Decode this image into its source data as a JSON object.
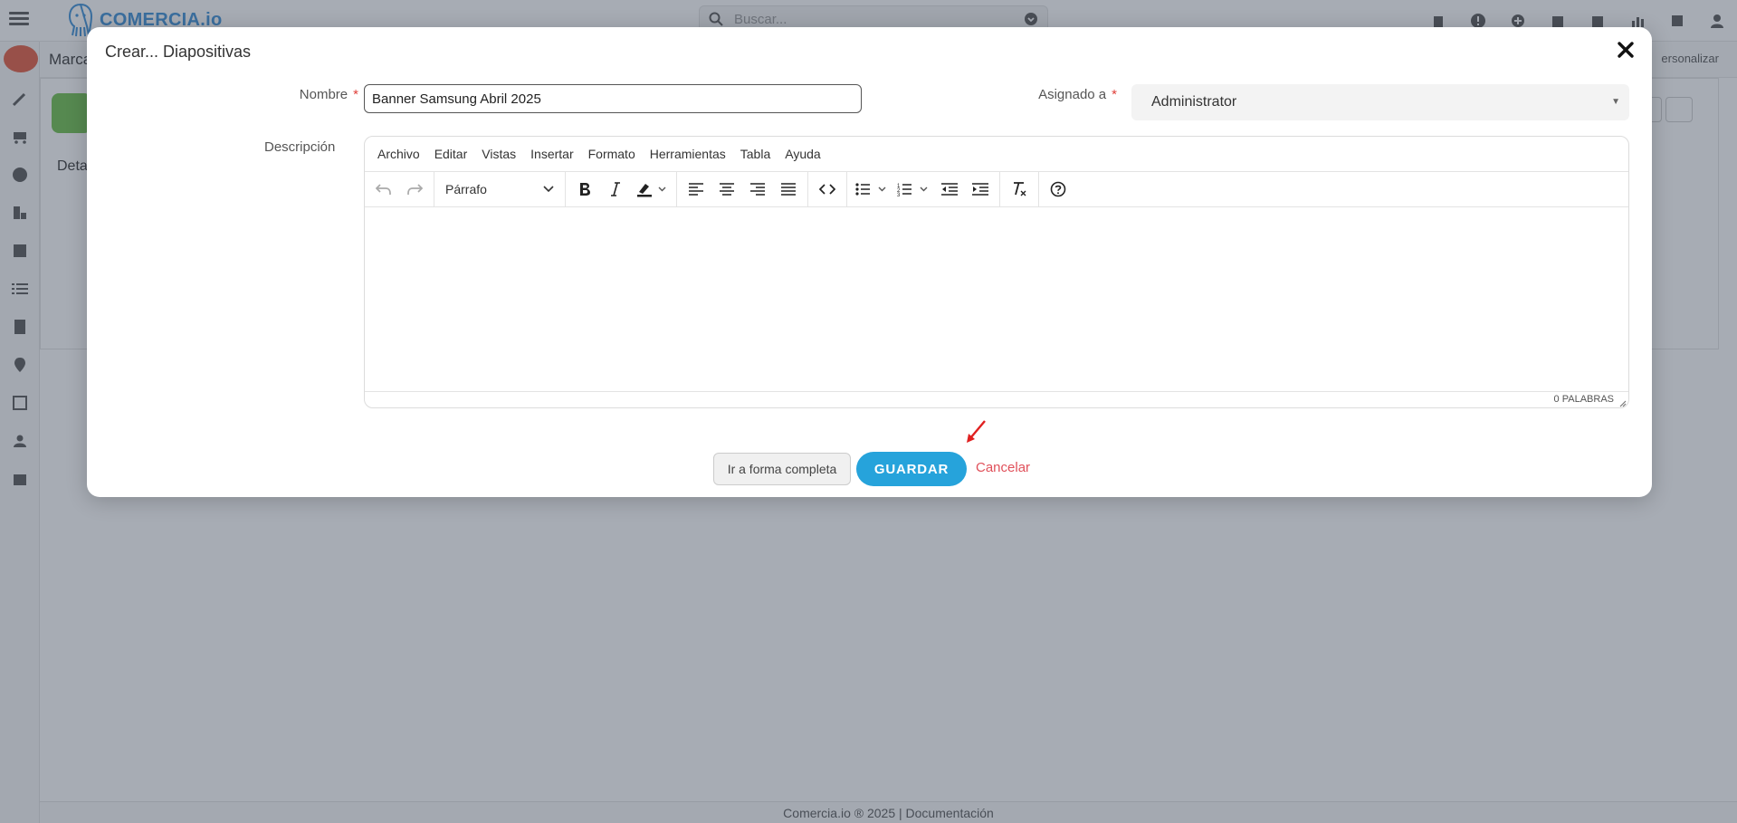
{
  "app": {
    "logo_text": "COMERCIA.io",
    "search_placeholder": "Buscar...",
    "breadcrumb_label": "Marca",
    "personalize_label": "ersonalizar",
    "panel_tab_label": "Deta",
    "footer_text": "Comercia.io ® 2025",
    "footer_link": "Documentación"
  },
  "modal": {
    "title": "Crear... Diapositivas",
    "name_label": "Nombre",
    "name_value": "Banner Samsung Abril 2025",
    "assigned_label": "Asignado a",
    "assigned_value": "Administrator",
    "description_label": "Descripción",
    "required_mark": "*"
  },
  "editor": {
    "menu": [
      "Archivo",
      "Editar",
      "Vistas",
      "Insertar",
      "Formato",
      "Herramientas",
      "Tabla",
      "Ayuda"
    ],
    "format_value": "Párrafo",
    "word_count": "0 PALABRAS"
  },
  "actions": {
    "full_form_label": "Ir a forma completa",
    "save_label": "GUARDAR",
    "cancel_label": "Cancelar"
  },
  "colors": {
    "save_button": "#26a3db",
    "cancel_link": "#e0505a",
    "required": "#e0403a",
    "accent": "#3a8fd8"
  }
}
